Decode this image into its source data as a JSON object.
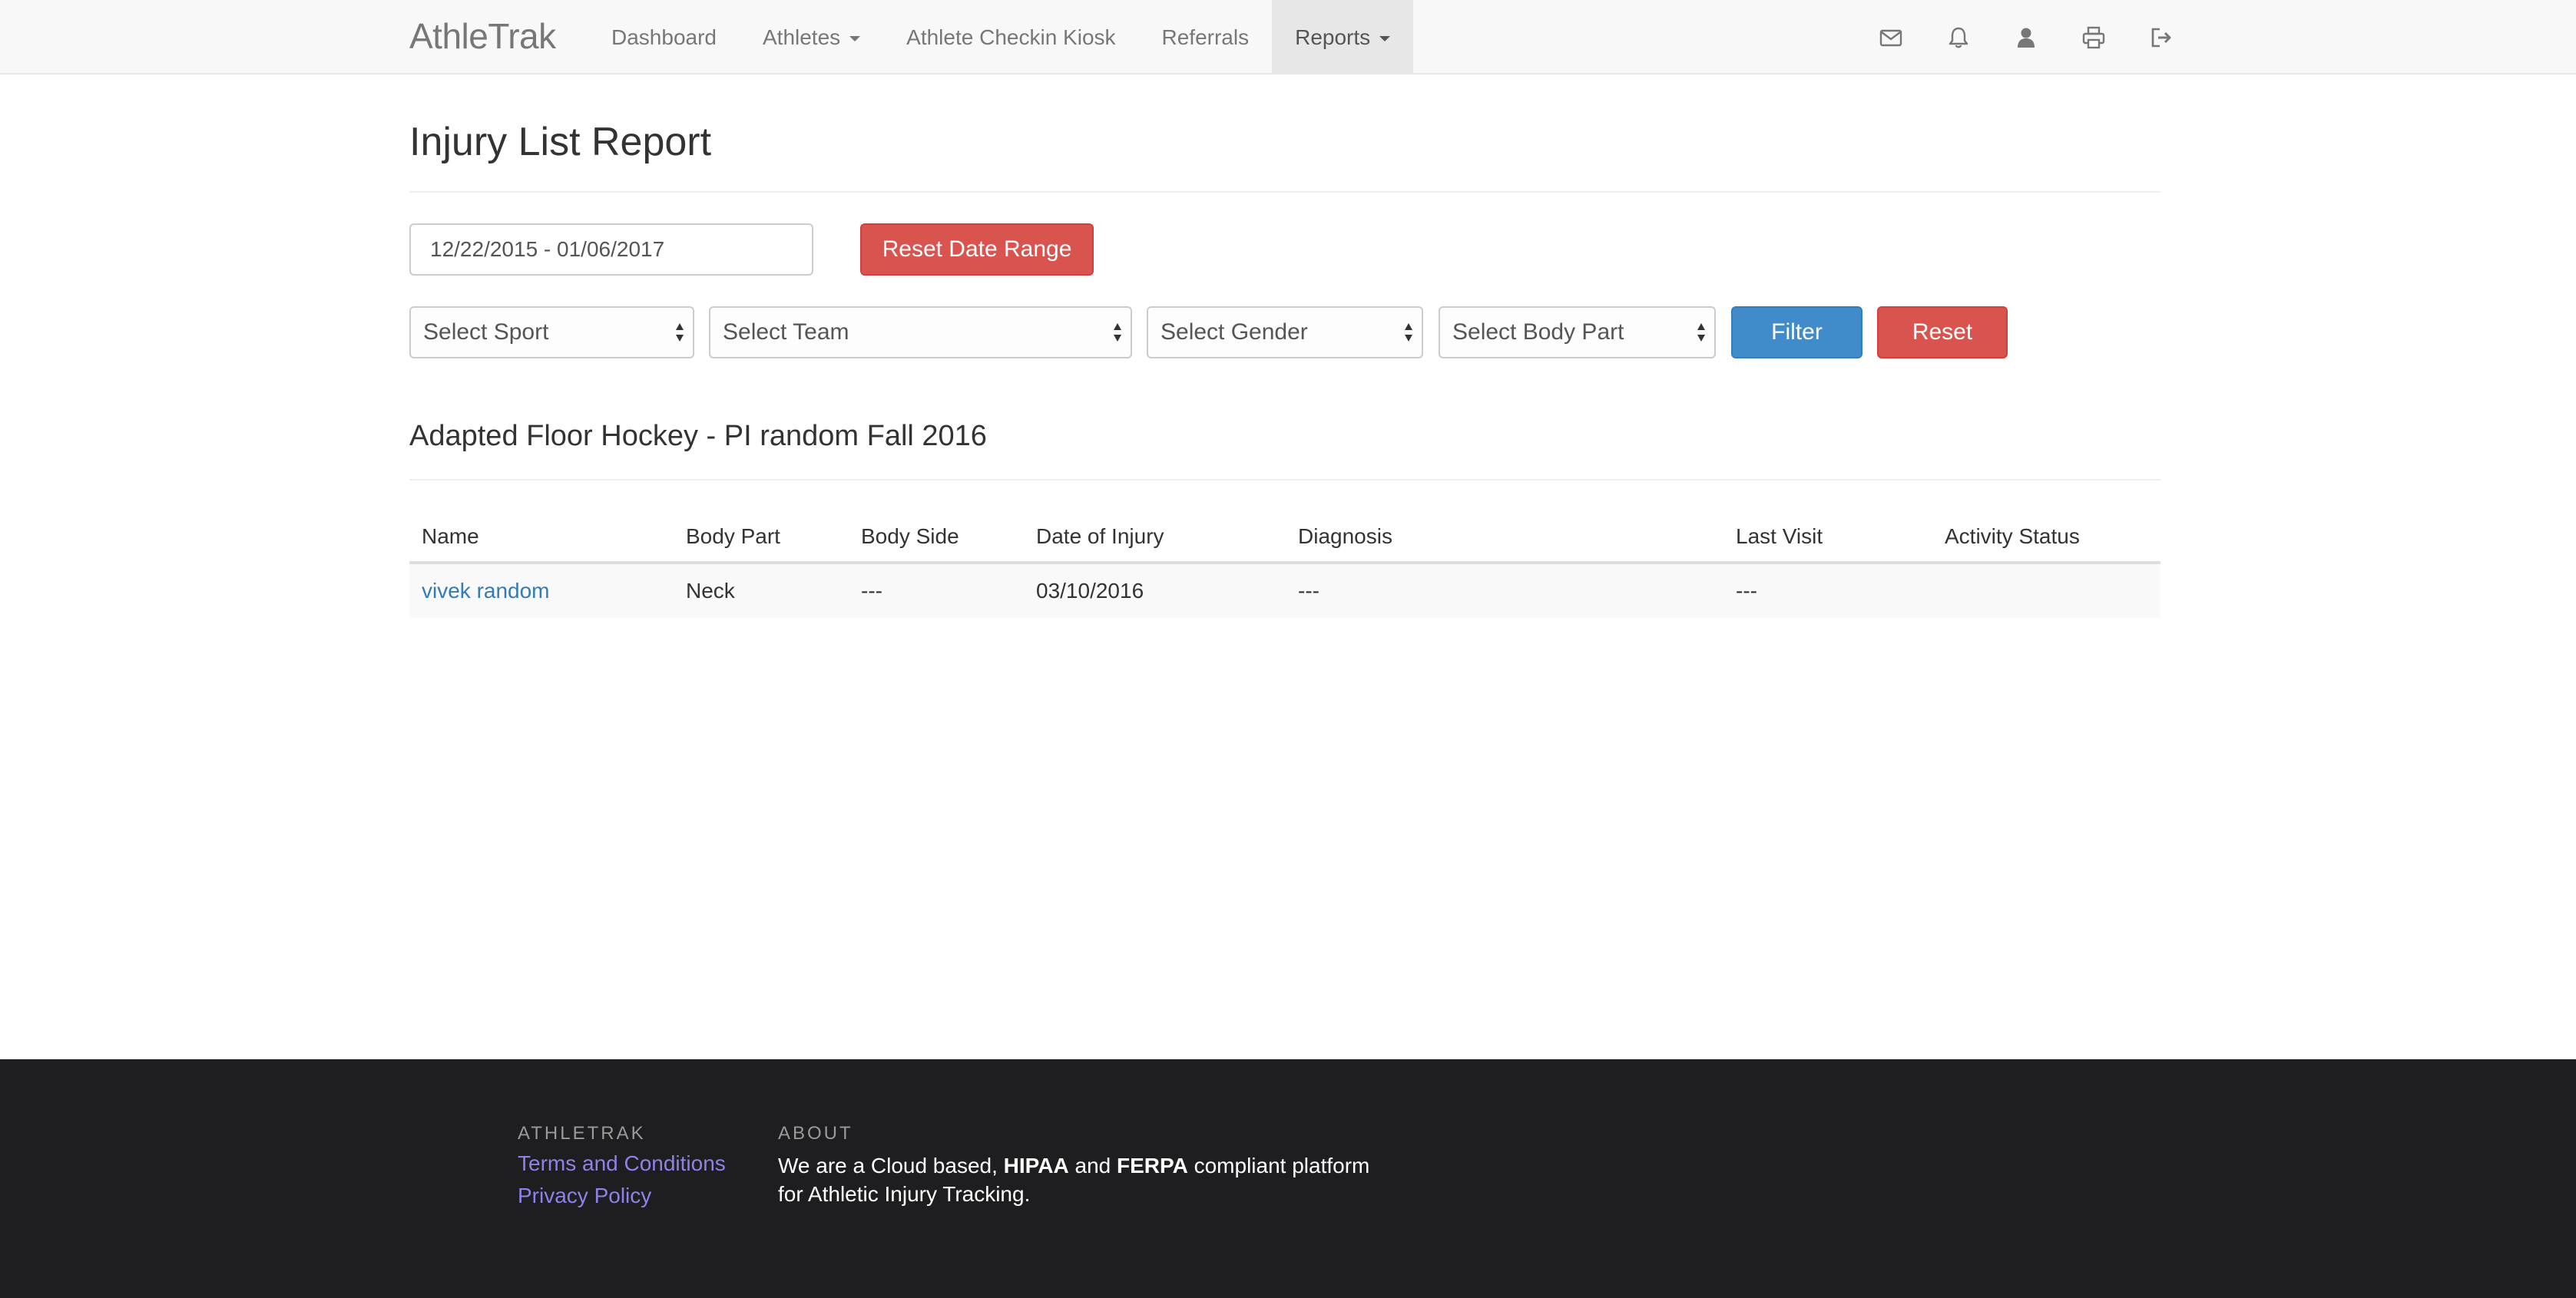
{
  "navbar": {
    "brand": "AthleTrak",
    "items": [
      {
        "label": "Dashboard",
        "dropdown": false,
        "active": false
      },
      {
        "label": "Athletes",
        "dropdown": true,
        "active": false
      },
      {
        "label": "Athlete Checkin Kiosk",
        "dropdown": false,
        "active": false
      },
      {
        "label": "Referrals",
        "dropdown": false,
        "active": false
      },
      {
        "label": "Reports",
        "dropdown": true,
        "active": true
      }
    ],
    "icons": [
      "envelope-icon",
      "bell-icon",
      "user-icon",
      "print-icon",
      "sign-out-icon"
    ]
  },
  "page": {
    "title": "Injury List Report",
    "date_range": "12/22/2015 - 01/06/2017",
    "reset_date_range_label": "Reset Date Range",
    "filters": {
      "sport": "Select Sport",
      "team": "Select Team",
      "gender": "Select Gender",
      "body_part": "Select Body Part"
    },
    "filter_button": "Filter",
    "reset_button": "Reset"
  },
  "report": {
    "section_title": "Adapted Floor Hockey - PI random Fall 2016",
    "columns": [
      "Name",
      "Body Part",
      "Body Side",
      "Date of Injury",
      "Diagnosis",
      "Last Visit",
      "Activity Status"
    ],
    "rows": [
      {
        "name": "vivek random",
        "body_part": "Neck",
        "body_side": "---",
        "date_of_injury": "03/10/2016",
        "diagnosis": "---",
        "last_visit": "---",
        "activity_status": ""
      }
    ]
  },
  "footer": {
    "company_heading": "ATHLETRAK",
    "terms_link": "Terms and Conditions",
    "privacy_link": "Privacy Policy",
    "about_heading": "ABOUT",
    "about_part1": "We are a Cloud based, ",
    "about_hipaa": "HIPAA",
    "about_part2": " and ",
    "about_ferpa": "FERPA",
    "about_part3": " compliant platform for Athletic Injury Tracking."
  },
  "colors": {
    "navbar_bg": "#f8f8f8",
    "danger": "#d9534f",
    "primary": "#428bca",
    "link": "#337ab7",
    "footer_bg": "#1e1e20",
    "footer_link": "#8d82e8"
  }
}
